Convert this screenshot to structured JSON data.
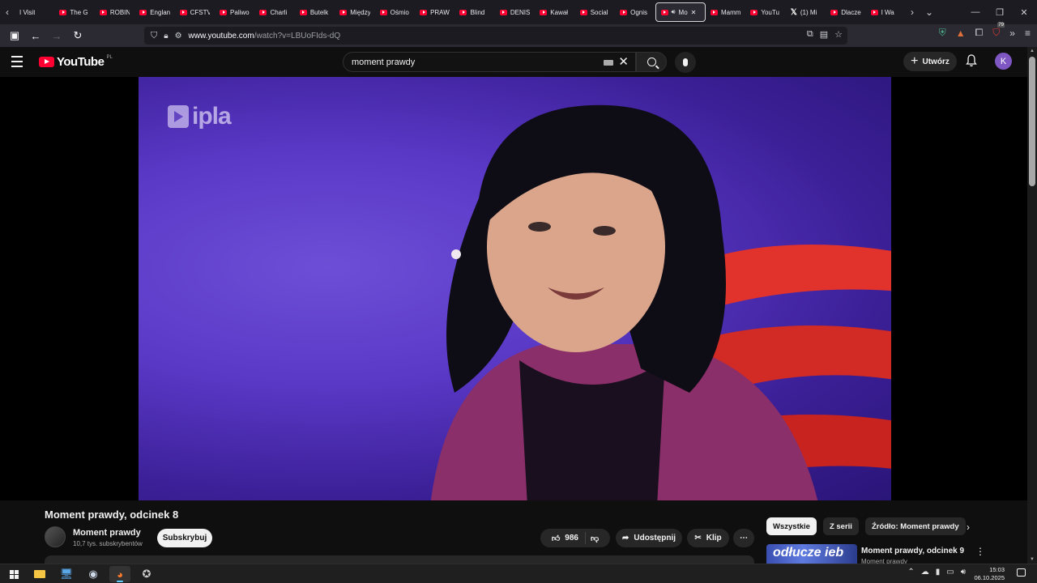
{
  "browser": {
    "tabs": [
      {
        "label": "I Visit",
        "favicon": "none"
      },
      {
        "label": "The G",
        "favicon": "youtube"
      },
      {
        "label": "ROBIN",
        "favicon": "youtube"
      },
      {
        "label": "Englan",
        "favicon": "youtube"
      },
      {
        "label": "CFSTV",
        "favicon": "youtube"
      },
      {
        "label": "Paliwo",
        "favicon": "youtube"
      },
      {
        "label": "Charli",
        "favicon": "youtube"
      },
      {
        "label": "Butelk",
        "favicon": "youtube"
      },
      {
        "label": "Między",
        "favicon": "youtube"
      },
      {
        "label": "Ośmio",
        "favicon": "youtube"
      },
      {
        "label": "PRAW",
        "favicon": "youtube"
      },
      {
        "label": "Blind",
        "favicon": "youtube"
      },
      {
        "label": "DENIS",
        "favicon": "youtube"
      },
      {
        "label": "Kawał",
        "favicon": "youtube"
      },
      {
        "label": "Social",
        "favicon": "youtube"
      },
      {
        "label": "Ognis",
        "favicon": "youtube"
      },
      {
        "label": "Mo",
        "favicon": "youtube",
        "active": true,
        "audio": true
      },
      {
        "label": "Mamm",
        "favicon": "youtube"
      },
      {
        "label": "YouTu",
        "favicon": "youtube"
      },
      {
        "label": "(1) Mi",
        "favicon": "x"
      },
      {
        "label": "Dlacze",
        "favicon": "youtube"
      },
      {
        "label": "I Wa",
        "favicon": "youtube"
      }
    ],
    "url_host": "www.youtube.com",
    "url_path": "/watch?v=LBUoFIds-dQ",
    "extension_badge": "79"
  },
  "youtube": {
    "logo_text": "YouTube",
    "region": "PL",
    "search_value": "moment prawdy",
    "create_label": "Utwórz",
    "avatar_letter": "K",
    "avatar_color": "#7e57c2"
  },
  "video": {
    "watermark": "ipla",
    "title": "Moment prawdy, odcinek 8",
    "channel_name": "Moment prawdy",
    "subscribers": "10,7 tys. subskrybentów",
    "subscribe_label": "Subskrybuj",
    "likes": "986",
    "share_label": "Udostępnij",
    "clip_label": "Klip"
  },
  "sidebar": {
    "chips": [
      {
        "label": "Wszystkie",
        "selected": true
      },
      {
        "label": "Z serii",
        "selected": false
      },
      {
        "label": "Źródło: Moment prawdy",
        "selected": false
      }
    ],
    "recommendation": {
      "title": "Moment prawdy, odcinek 9",
      "channel": "Moment prawdy",
      "thumb_text": "odłucze ieb"
    }
  },
  "taskbar": {
    "time": "15:03",
    "date": "06.10.2025"
  }
}
